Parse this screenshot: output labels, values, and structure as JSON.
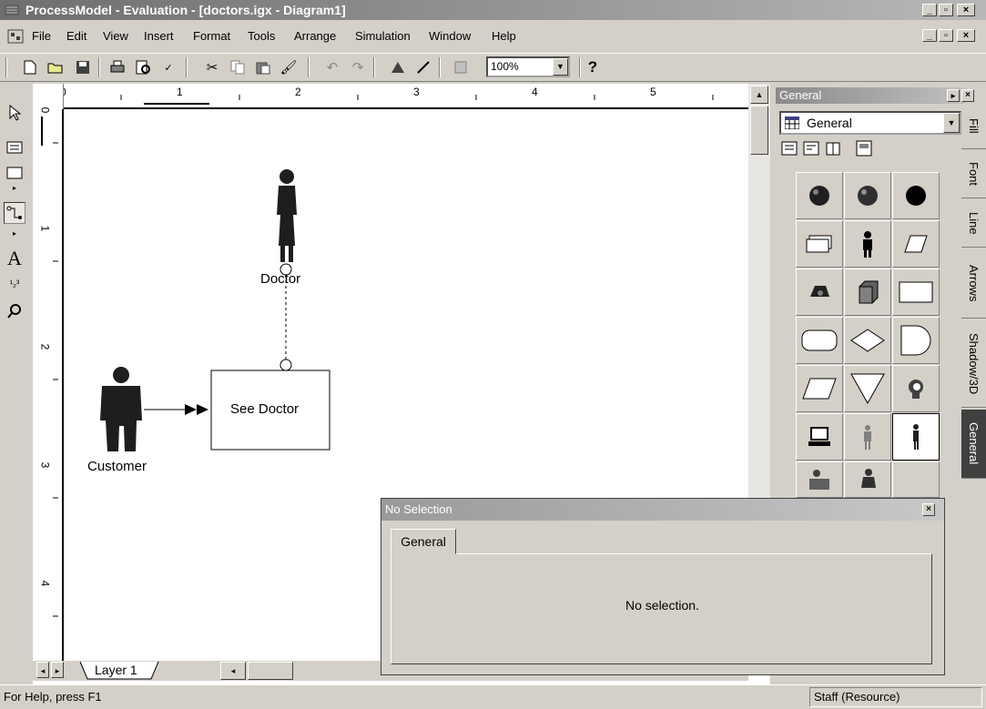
{
  "window": {
    "title": "ProcessModel - Evaluation - [doctors.igx - Diagram1]",
    "controls": [
      "_",
      "🗗",
      "×"
    ]
  },
  "menu": {
    "items": [
      "File",
      "Edit",
      "View",
      "Insert",
      "Format",
      "Tools",
      "Arrange",
      "Simulation",
      "Window",
      "Help"
    ]
  },
  "toolbar": {
    "zoom_value": "100%",
    "help_label": "?"
  },
  "ruler": {
    "unit": "in",
    "h_numbers": [
      "0",
      "1",
      "2",
      "3",
      "4",
      "5"
    ],
    "v_numbers": [
      "0",
      "1",
      "2",
      "3",
      "4"
    ]
  },
  "diagram": {
    "doctor_label": "Doctor",
    "customer_label": "Customer",
    "activity_label": "See Doctor"
  },
  "layers": {
    "tab_label": "Layer 1"
  },
  "palette": {
    "title": "General",
    "selected": "General",
    "tabs": [
      "Fill",
      "Font",
      "Line",
      "Arrows",
      "Shadow/3D",
      "General"
    ]
  },
  "properties": {
    "title": "No Selection",
    "tab_label": "General",
    "message": "No selection."
  },
  "status": {
    "left": "For Help, press F1",
    "right": "Staff (Resource)"
  }
}
